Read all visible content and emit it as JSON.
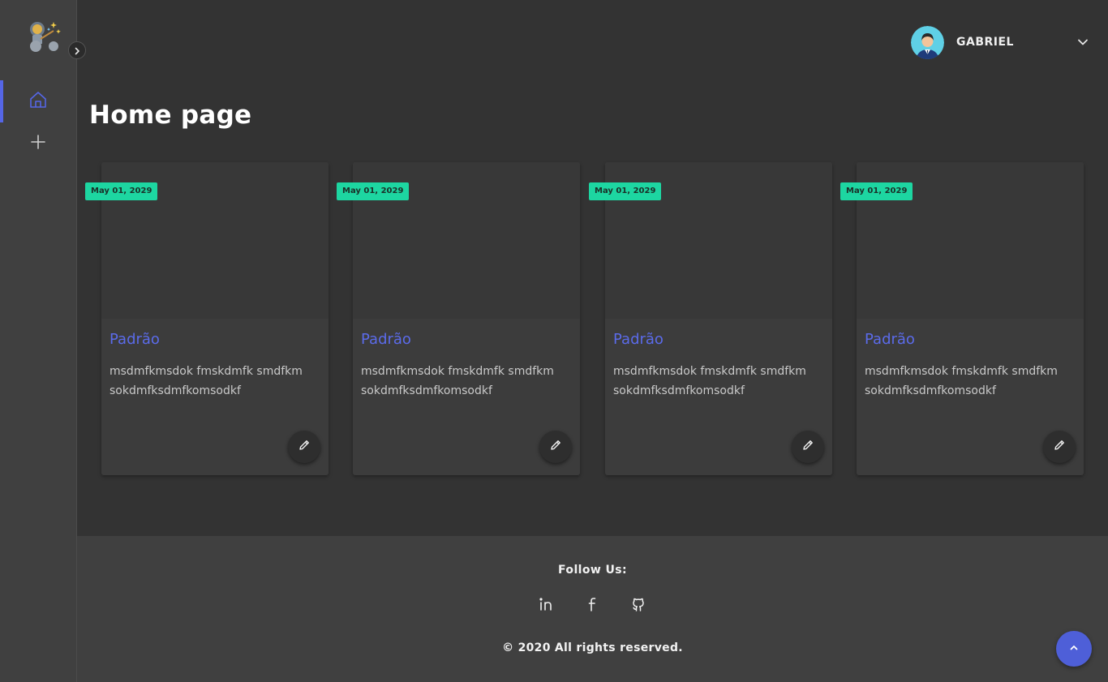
{
  "colors": {
    "background": "#333333",
    "sidebar": "#404040",
    "accent": "#5566e6",
    "date_badge": "#1dd6a1",
    "card": "#3c3c3c"
  },
  "sidebar": {
    "logo_icon": "astronaut-logo-icon",
    "collapse_icon": "chevron-right-icon",
    "items": [
      {
        "icon": "home-icon",
        "active": true
      },
      {
        "icon": "plus-icon",
        "active": false
      }
    ]
  },
  "header": {
    "user": {
      "name": "GABRIEL",
      "avatar_icon": "user-avatar",
      "menu_icon": "chevron-down-icon"
    }
  },
  "page": {
    "title": "Home page"
  },
  "cards": [
    {
      "date": "May 01, 2029",
      "title": "Padrão",
      "description": "msdmfkmsdok fmskdmfk smdfkm sokdmfksdmfkomsodkf",
      "action_icon": "pencil-icon"
    },
    {
      "date": "May 01, 2029",
      "title": "Padrão",
      "description": "msdmfkmsdok fmskdmfk smdfkm sokdmfksdmfkomsodkf",
      "action_icon": "pencil-icon"
    },
    {
      "date": "May 01, 2029",
      "title": "Padrão",
      "description": "msdmfkmsdok fmskdmfk smdfkm sokdmfksdmfkomsodkf",
      "action_icon": "pencil-icon"
    },
    {
      "date": "May 01, 2029",
      "title": "Padrão",
      "description": "msdmfkmsdok fmskdmfk smdfkm sokdmfksdmfkomsodkf",
      "action_icon": "pencil-icon"
    }
  ],
  "footer": {
    "follow_label": "Follow Us:",
    "social_icons": [
      "linkedin-icon",
      "facebook-icon",
      "github-icon"
    ],
    "copyright": "© 2020 All rights reserved."
  },
  "back_to_top_icon": "chevron-up-icon"
}
